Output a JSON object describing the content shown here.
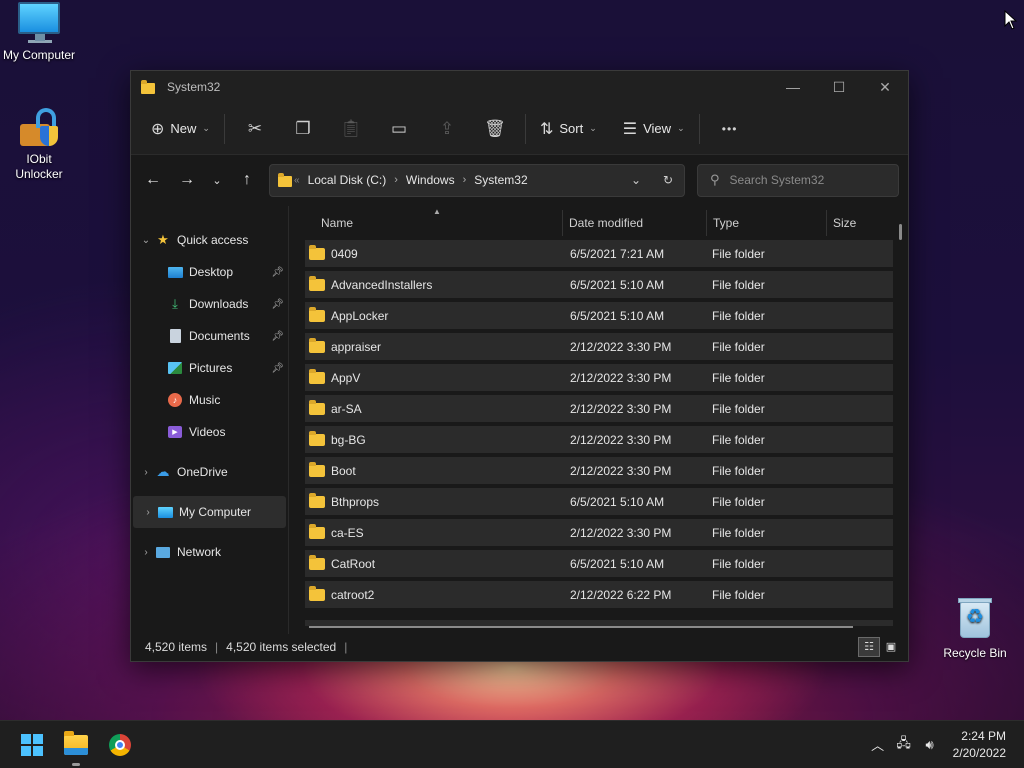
{
  "desktop": {
    "icons": [
      {
        "label": "My Computer",
        "icon": "computer-icon"
      },
      {
        "label": "IObit\nUnlocker",
        "icon": "iobit-unlocker-icon"
      },
      {
        "label": "Recycle Bin",
        "icon": "recycle-bin-icon"
      }
    ]
  },
  "window": {
    "title": "System32",
    "controls": {
      "minimize": "—",
      "maximize": "☐",
      "close": "✕"
    }
  },
  "toolbar": {
    "new_label": "New",
    "sort_label": "Sort",
    "view_label": "View",
    "more_label": "•••",
    "icons": [
      "cut-icon",
      "copy-icon",
      "paste-icon",
      "rename-icon",
      "share-icon",
      "delete-icon"
    ]
  },
  "navigation": {
    "back": "←",
    "forward": "→",
    "recent": "⌄",
    "up": "↑",
    "breadcrumb": [
      "Local Disk (C:)",
      "Windows",
      "System32"
    ],
    "search_placeholder": "Search System32"
  },
  "sidebar": {
    "quick_access": "Quick access",
    "quick_items": [
      {
        "label": "Desktop",
        "icon": "desktop-icon",
        "pinned": true
      },
      {
        "label": "Downloads",
        "icon": "download-icon",
        "pinned": true
      },
      {
        "label": "Documents",
        "icon": "document-icon",
        "pinned": true
      },
      {
        "label": "Pictures",
        "icon": "pictures-icon",
        "pinned": true
      },
      {
        "label": "Music",
        "icon": "music-icon",
        "pinned": false
      },
      {
        "label": "Videos",
        "icon": "videos-icon",
        "pinned": false
      }
    ],
    "onedrive": "OneDrive",
    "my_computer": "My Computer",
    "network": "Network"
  },
  "columns": {
    "name": "Name",
    "date": "Date modified",
    "type": "Type",
    "size": "Size"
  },
  "files": [
    {
      "name": "0409",
      "date": "6/5/2021 7:21 AM",
      "type": "File folder",
      "size": ""
    },
    {
      "name": "AdvancedInstallers",
      "date": "6/5/2021 5:10 AM",
      "type": "File folder",
      "size": ""
    },
    {
      "name": "AppLocker",
      "date": "6/5/2021 5:10 AM",
      "type": "File folder",
      "size": ""
    },
    {
      "name": "appraiser",
      "date": "2/12/2022 3:30 PM",
      "type": "File folder",
      "size": ""
    },
    {
      "name": "AppV",
      "date": "2/12/2022 3:30 PM",
      "type": "File folder",
      "size": ""
    },
    {
      "name": "ar-SA",
      "date": "2/12/2022 3:30 PM",
      "type": "File folder",
      "size": ""
    },
    {
      "name": "bg-BG",
      "date": "2/12/2022 3:30 PM",
      "type": "File folder",
      "size": ""
    },
    {
      "name": "Boot",
      "date": "2/12/2022 3:30 PM",
      "type": "File folder",
      "size": ""
    },
    {
      "name": "Bthprops",
      "date": "6/5/2021 5:10 AM",
      "type": "File folder",
      "size": ""
    },
    {
      "name": "ca-ES",
      "date": "2/12/2022 3:30 PM",
      "type": "File folder",
      "size": ""
    },
    {
      "name": "CatRoot",
      "date": "6/5/2021 5:10 AM",
      "type": "File folder",
      "size": ""
    },
    {
      "name": "catroot2",
      "date": "2/12/2022 6:22 PM",
      "type": "File folder",
      "size": ""
    }
  ],
  "status": {
    "item_count": "4,520 items",
    "selected_count": "4,520 items selected"
  },
  "taskbar": {
    "apps": [
      "start-icon",
      "file-explorer-icon",
      "chrome-icon"
    ],
    "time": "2:24 PM",
    "date": "2/20/2022"
  },
  "colors": {
    "folder": "#f4c33a",
    "window_bg": "#191919",
    "row_bg": "#2b2b2b",
    "accent": "#4cc2ff"
  }
}
